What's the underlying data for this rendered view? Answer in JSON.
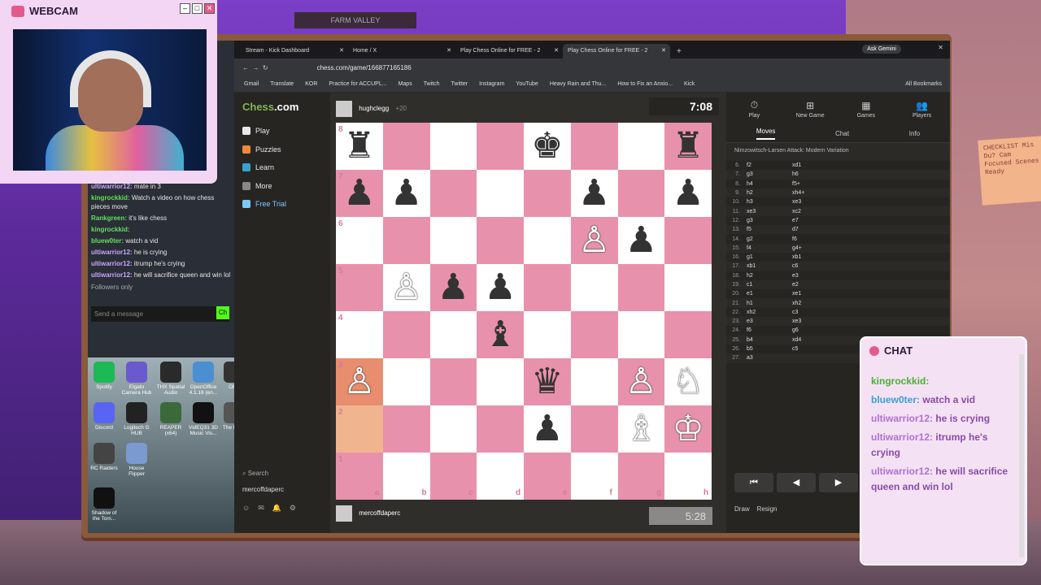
{
  "webcam": {
    "title": "WEBCAM"
  },
  "stream_chat": {
    "lines": [
      {
        "user": "ultiwarrior12:",
        "text": "mate in 3"
      },
      {
        "user": "kingrockkid:",
        "text": "Watch a video on how chess pieces move"
      },
      {
        "user": "Rankgreen:",
        "text": "it's like chess"
      },
      {
        "user": "kingrockkid:",
        "text": ""
      },
      {
        "user": "bluew0ter:",
        "text": "watch a vid"
      },
      {
        "user": "ultiwarrior12:",
        "text": "he is crying"
      },
      {
        "user": "ultiwarrior12:",
        "text": "itrump he's crying"
      },
      {
        "user": "ultiwarrior12:",
        "text": "he will sacrifice queen and win lol"
      }
    ],
    "followers": "Followers only",
    "send": "Send a message",
    "chat_btn": "Ch"
  },
  "desktop_icons": [
    {
      "label": "Spotify",
      "color": "#1db954"
    },
    {
      "label": "Elgato Camera Hub",
      "color": "#6a5acd"
    },
    {
      "label": "THX Spatial Audio",
      "color": "#2a2a2a"
    },
    {
      "label": "OpenOffice 4.1.16 (en...",
      "color": "#4a90d0"
    },
    {
      "label": "OBS",
      "color": "#333"
    },
    {
      "label": "Discord",
      "color": "#5865f2"
    },
    {
      "label": "Logitech G HUB",
      "color": "#222"
    },
    {
      "label": "REAPER (x64)",
      "color": "#3a6a3a"
    },
    {
      "label": "VidEQ31 3D Music Vis...",
      "color": "#111"
    },
    {
      "label": "The Party",
      "color": "#555"
    },
    {
      "label": "RC Raiders",
      "color": "#444"
    },
    {
      "label": "House Flipper",
      "color": "#7a9ad0"
    },
    {
      "label": "Shadow of the Tom...",
      "color": "#111"
    }
  ],
  "browser": {
    "tabs": [
      {
        "label": "Stream - Kick Dashboard"
      },
      {
        "label": "Home / X"
      },
      {
        "label": "Play Chess Online for FREE - 2"
      },
      {
        "label": "Play Chess Online for FREE - 2"
      }
    ],
    "gemini": "Ask Gemini",
    "url": "chess.com/game/166877165186",
    "bookmarks": [
      "Gmail",
      "Translate",
      "KOR",
      "Practice for ACCUPL...",
      "Maps",
      "Twitch",
      "Twitter",
      "Instagram",
      "YouTube",
      "Heavy Rain and Thu...",
      "How to Fix an Anxio...",
      "Kick"
    ],
    "all_bookmarks": "All Bookmarks"
  },
  "chess": {
    "logo": "Chess",
    "logo_suffix": ".com",
    "nav": [
      {
        "label": "Play",
        "color": "#e8e8e8"
      },
      {
        "label": "Puzzles",
        "color": "#f08a3a"
      },
      {
        "label": "Learn",
        "color": "#3aa0d0"
      },
      {
        "label": "More",
        "color": "#888"
      },
      {
        "label": "Free Trial",
        "color": "#7ec8ff"
      }
    ],
    "search": "Search",
    "me": "mercoffdaperc",
    "opponent": {
      "name": "hughclegg",
      "rating": "+20"
    },
    "opponent_clock": "7:08",
    "player": {
      "name": "mercoffdaperc"
    },
    "player_clock": "5:28",
    "panel_tabs": [
      "Play",
      "New Game",
      "Games",
      "Players"
    ],
    "sub_tabs": [
      "Moves",
      "Chat",
      "Info"
    ],
    "opening": "Nimzowitsch-Larsen Attack: Modern Variation",
    "moves": [
      {
        "n": "6.",
        "w": "f2",
        "b": "xd1"
      },
      {
        "n": "7.",
        "w": "g3",
        "b": "h6"
      },
      {
        "n": "8.",
        "w": "h4",
        "b": "f5+"
      },
      {
        "n": "9.",
        "w": "h2",
        "b": "xh4+"
      },
      {
        "n": "10.",
        "w": "h3",
        "b": "xe3"
      },
      {
        "n": "11.",
        "w": "xe3",
        "b": "xc2"
      },
      {
        "n": "12.",
        "w": "g3",
        "b": "e7"
      },
      {
        "n": "13.",
        "w": "f5",
        "b": "d7"
      },
      {
        "n": "14.",
        "w": "g2",
        "b": "f6"
      },
      {
        "n": "15.",
        "w": "f4",
        "b": "g4+"
      },
      {
        "n": "16.",
        "w": "g1",
        "b": "xb1"
      },
      {
        "n": "17.",
        "w": "xb1",
        "b": "c6"
      },
      {
        "n": "18.",
        "w": "h2",
        "b": "e3"
      },
      {
        "n": "19.",
        "w": "c1",
        "b": "e2"
      },
      {
        "n": "20.",
        "w": "e1",
        "b": "xe1"
      },
      {
        "n": "21.",
        "w": "h1",
        "b": "xh2"
      },
      {
        "n": "22.",
        "w": "xh2",
        "b": "c3"
      },
      {
        "n": "23.",
        "w": "e3",
        "b": "xe3"
      },
      {
        "n": "24.",
        "w": "f6",
        "b": "g6"
      },
      {
        "n": "25.",
        "w": "b4",
        "b": "xd4"
      },
      {
        "n": "26.",
        "w": "b5",
        "b": "c5"
      },
      {
        "n": "27.",
        "w": "a3",
        "b": ""
      }
    ],
    "draw": "Draw",
    "resign": "Resign",
    "ranks": [
      "8",
      "7",
      "6",
      "5",
      "4",
      "3",
      "2",
      "1"
    ],
    "files": [
      "a",
      "b",
      "c",
      "d",
      "e",
      "f",
      "g",
      "h"
    ],
    "pieces": [
      {
        "sq": "a8",
        "p": "♜",
        "c": "b"
      },
      {
        "sq": "e8",
        "p": "♚",
        "c": "b"
      },
      {
        "sq": "h8",
        "p": "♜",
        "c": "b"
      },
      {
        "sq": "a7",
        "p": "♟",
        "c": "b"
      },
      {
        "sq": "b7",
        "p": "♟",
        "c": "b"
      },
      {
        "sq": "f7",
        "p": "♟",
        "c": "b"
      },
      {
        "sq": "h7",
        "p": "♟",
        "c": "b"
      },
      {
        "sq": "f6",
        "p": "♙",
        "c": "w"
      },
      {
        "sq": "g6",
        "p": "♟",
        "c": "b"
      },
      {
        "sq": "b5",
        "p": "♙",
        "c": "w"
      },
      {
        "sq": "c5",
        "p": "♟",
        "c": "b"
      },
      {
        "sq": "d5",
        "p": "♟",
        "c": "b"
      },
      {
        "sq": "d4",
        "p": "♝",
        "c": "b"
      },
      {
        "sq": "a3",
        "p": "♙",
        "c": "w"
      },
      {
        "sq": "e3",
        "p": "♛",
        "c": "b"
      },
      {
        "sq": "g3",
        "p": "♙",
        "c": "w"
      },
      {
        "sq": "h3",
        "p": "♘",
        "c": "w"
      },
      {
        "sq": "e2",
        "p": "♟",
        "c": "b"
      },
      {
        "sq": "g2",
        "p": "♗",
        "c": "w"
      },
      {
        "sq": "h2",
        "p": "♔",
        "c": "w"
      }
    ]
  },
  "overlay_chat": {
    "title": "CHAT",
    "messages": [
      {
        "user": "kingrockkid:",
        "text": "",
        "cls": "u1"
      },
      {
        "user": "bluew0ter:",
        "text": "watch a vid",
        "cls": "u2"
      },
      {
        "user": "ultiwarrior12:",
        "text": "he is crying",
        "cls": "u3"
      },
      {
        "user": "ultiwarrior12:",
        "text": "itrump he's crying",
        "cls": "u3"
      },
      {
        "user": "ultiwarrior12:",
        "text": "he will sacrifice queen and win lol",
        "cls": "u3"
      }
    ]
  },
  "note": "CHECKLIST Mis Du? Cam Focused Scenes Ready",
  "sign": "FARM VALLEY"
}
